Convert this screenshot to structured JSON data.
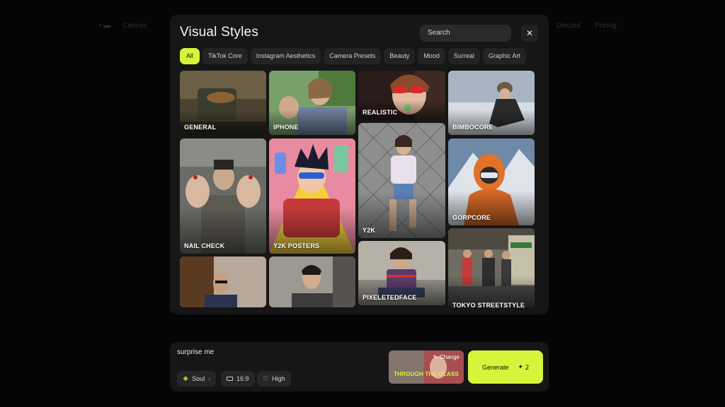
{
  "background_nav": {
    "left_label": "Canvas",
    "right_label_1": "Discord",
    "right_label_2": "Pricing"
  },
  "modal": {
    "title": "Visual Styles",
    "search_placeholder": "Search",
    "close_icon": "close-icon"
  },
  "filters": [
    "All",
    "TikTok Core",
    "Instagram Aesthetics",
    "Camera Presets",
    "Beauty",
    "Mood",
    "Surreal",
    "Graphic Art"
  ],
  "active_filter": "All",
  "styles": [
    {
      "label": "GENERAL"
    },
    {
      "label": "IPHONE"
    },
    {
      "label": "REALISTIC"
    },
    {
      "label": "BIMBOCORE"
    },
    {
      "label": "NAIL CHECK"
    },
    {
      "label": "Y2K POSTERS"
    },
    {
      "label": "Y2K"
    },
    {
      "label": "GORPCORE"
    },
    {
      "label": ""
    },
    {
      "label": ""
    },
    {
      "label": "PIXELETEDFACE"
    },
    {
      "label": "TOKYO STREETSTYLE"
    }
  ],
  "prompt": {
    "text": "surprise me",
    "model": "Soul",
    "aspect": "16:9",
    "quality": "High",
    "selected_style": "THROUGH THE GLASS",
    "change_label": "Change",
    "generate_label": "Generate",
    "generate_cost": "2"
  },
  "colors": {
    "accent": "#d6f53a",
    "panel": "#161616",
    "chip": "#232323"
  }
}
